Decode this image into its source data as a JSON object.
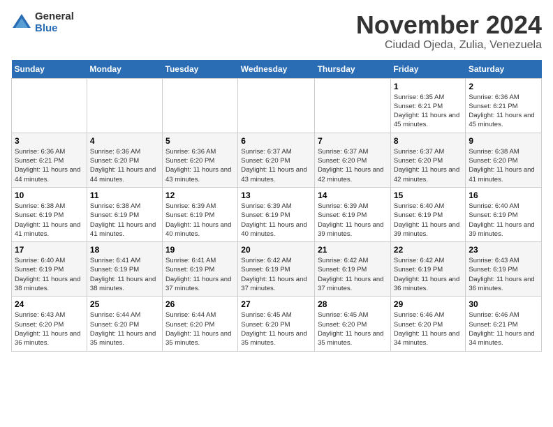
{
  "logo": {
    "text_general": "General",
    "text_blue": "Blue"
  },
  "title": {
    "month": "November 2024",
    "location": "Ciudad Ojeda, Zulia, Venezuela"
  },
  "headers": [
    "Sunday",
    "Monday",
    "Tuesday",
    "Wednesday",
    "Thursday",
    "Friday",
    "Saturday"
  ],
  "weeks": [
    [
      {
        "day": "",
        "info": ""
      },
      {
        "day": "",
        "info": ""
      },
      {
        "day": "",
        "info": ""
      },
      {
        "day": "",
        "info": ""
      },
      {
        "day": "",
        "info": ""
      },
      {
        "day": "1",
        "info": "Sunrise: 6:35 AM\nSunset: 6:21 PM\nDaylight: 11 hours and 45 minutes."
      },
      {
        "day": "2",
        "info": "Sunrise: 6:36 AM\nSunset: 6:21 PM\nDaylight: 11 hours and 45 minutes."
      }
    ],
    [
      {
        "day": "3",
        "info": "Sunrise: 6:36 AM\nSunset: 6:21 PM\nDaylight: 11 hours and 44 minutes."
      },
      {
        "day": "4",
        "info": "Sunrise: 6:36 AM\nSunset: 6:20 PM\nDaylight: 11 hours and 44 minutes."
      },
      {
        "day": "5",
        "info": "Sunrise: 6:36 AM\nSunset: 6:20 PM\nDaylight: 11 hours and 43 minutes."
      },
      {
        "day": "6",
        "info": "Sunrise: 6:37 AM\nSunset: 6:20 PM\nDaylight: 11 hours and 43 minutes."
      },
      {
        "day": "7",
        "info": "Sunrise: 6:37 AM\nSunset: 6:20 PM\nDaylight: 11 hours and 42 minutes."
      },
      {
        "day": "8",
        "info": "Sunrise: 6:37 AM\nSunset: 6:20 PM\nDaylight: 11 hours and 42 minutes."
      },
      {
        "day": "9",
        "info": "Sunrise: 6:38 AM\nSunset: 6:20 PM\nDaylight: 11 hours and 41 minutes."
      }
    ],
    [
      {
        "day": "10",
        "info": "Sunrise: 6:38 AM\nSunset: 6:19 PM\nDaylight: 11 hours and 41 minutes."
      },
      {
        "day": "11",
        "info": "Sunrise: 6:38 AM\nSunset: 6:19 PM\nDaylight: 11 hours and 41 minutes."
      },
      {
        "day": "12",
        "info": "Sunrise: 6:39 AM\nSunset: 6:19 PM\nDaylight: 11 hours and 40 minutes."
      },
      {
        "day": "13",
        "info": "Sunrise: 6:39 AM\nSunset: 6:19 PM\nDaylight: 11 hours and 40 minutes."
      },
      {
        "day": "14",
        "info": "Sunrise: 6:39 AM\nSunset: 6:19 PM\nDaylight: 11 hours and 39 minutes."
      },
      {
        "day": "15",
        "info": "Sunrise: 6:40 AM\nSunset: 6:19 PM\nDaylight: 11 hours and 39 minutes."
      },
      {
        "day": "16",
        "info": "Sunrise: 6:40 AM\nSunset: 6:19 PM\nDaylight: 11 hours and 39 minutes."
      }
    ],
    [
      {
        "day": "17",
        "info": "Sunrise: 6:40 AM\nSunset: 6:19 PM\nDaylight: 11 hours and 38 minutes."
      },
      {
        "day": "18",
        "info": "Sunrise: 6:41 AM\nSunset: 6:19 PM\nDaylight: 11 hours and 38 minutes."
      },
      {
        "day": "19",
        "info": "Sunrise: 6:41 AM\nSunset: 6:19 PM\nDaylight: 11 hours and 37 minutes."
      },
      {
        "day": "20",
        "info": "Sunrise: 6:42 AM\nSunset: 6:19 PM\nDaylight: 11 hours and 37 minutes."
      },
      {
        "day": "21",
        "info": "Sunrise: 6:42 AM\nSunset: 6:19 PM\nDaylight: 11 hours and 37 minutes."
      },
      {
        "day": "22",
        "info": "Sunrise: 6:42 AM\nSunset: 6:19 PM\nDaylight: 11 hours and 36 minutes."
      },
      {
        "day": "23",
        "info": "Sunrise: 6:43 AM\nSunset: 6:19 PM\nDaylight: 11 hours and 36 minutes."
      }
    ],
    [
      {
        "day": "24",
        "info": "Sunrise: 6:43 AM\nSunset: 6:20 PM\nDaylight: 11 hours and 36 minutes."
      },
      {
        "day": "25",
        "info": "Sunrise: 6:44 AM\nSunset: 6:20 PM\nDaylight: 11 hours and 35 minutes."
      },
      {
        "day": "26",
        "info": "Sunrise: 6:44 AM\nSunset: 6:20 PM\nDaylight: 11 hours and 35 minutes."
      },
      {
        "day": "27",
        "info": "Sunrise: 6:45 AM\nSunset: 6:20 PM\nDaylight: 11 hours and 35 minutes."
      },
      {
        "day": "28",
        "info": "Sunrise: 6:45 AM\nSunset: 6:20 PM\nDaylight: 11 hours and 35 minutes."
      },
      {
        "day": "29",
        "info": "Sunrise: 6:46 AM\nSunset: 6:20 PM\nDaylight: 11 hours and 34 minutes."
      },
      {
        "day": "30",
        "info": "Sunrise: 6:46 AM\nSunset: 6:21 PM\nDaylight: 11 hours and 34 minutes."
      }
    ]
  ]
}
